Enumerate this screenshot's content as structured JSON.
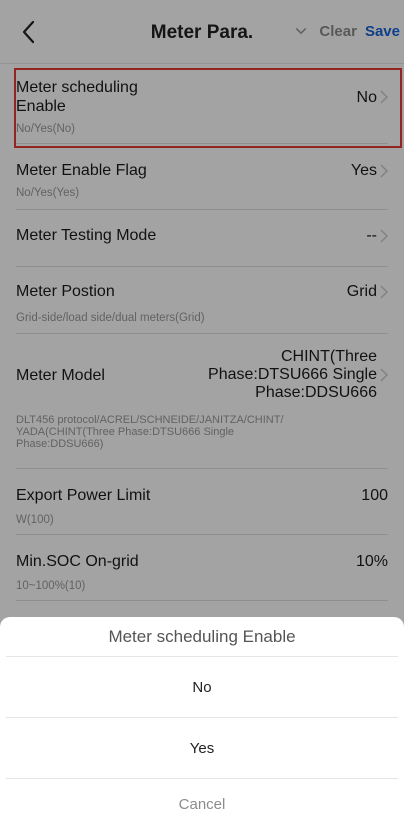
{
  "header": {
    "title": "Meter Para.",
    "clear_label": "Clear",
    "save_label": "Save"
  },
  "rows": [
    {
      "label": "Meter scheduling\nEnable",
      "value": "No",
      "hint": "No/Yes(No)"
    },
    {
      "label": "Meter Enable Flag",
      "value": "Yes",
      "hint": "No/Yes(Yes)"
    },
    {
      "label": "Meter Testing Mode",
      "value": "--",
      "hint": ""
    },
    {
      "label": "Meter Postion",
      "value": "Grid",
      "hint": "Grid-side/load side/dual meters(Grid)"
    },
    {
      "label": "Meter Model",
      "value": "CHINT(Three\nPhase:DTSU666 Single\nPhase:DDSU666",
      "hint": "DLT456 protocol/ACREL/SCHNEIDE/JANITZA/CHINT/\nYADA(CHINT(Three Phase:DTSU666 Single\nPhase:DDSU666)"
    },
    {
      "label": "Export Power Limit",
      "value": "100",
      "hint": "W(100)"
    },
    {
      "label": "Min.SOC On-grid",
      "value": "10%",
      "hint": "10~100%(10)"
    }
  ],
  "sheet": {
    "title": "Meter scheduling Enable",
    "options": [
      "No",
      "Yes"
    ],
    "cancel_label": "Cancel"
  },
  "colors": {
    "accent": "#1a63d6",
    "highlight": "#e53935",
    "overlay": "rgba(0,0,0,0.36)"
  },
  "icons": {
    "back": "chevron-left-icon",
    "dropdown": "chevron-down-icon",
    "row_arrow": "chevron-right-icon"
  }
}
